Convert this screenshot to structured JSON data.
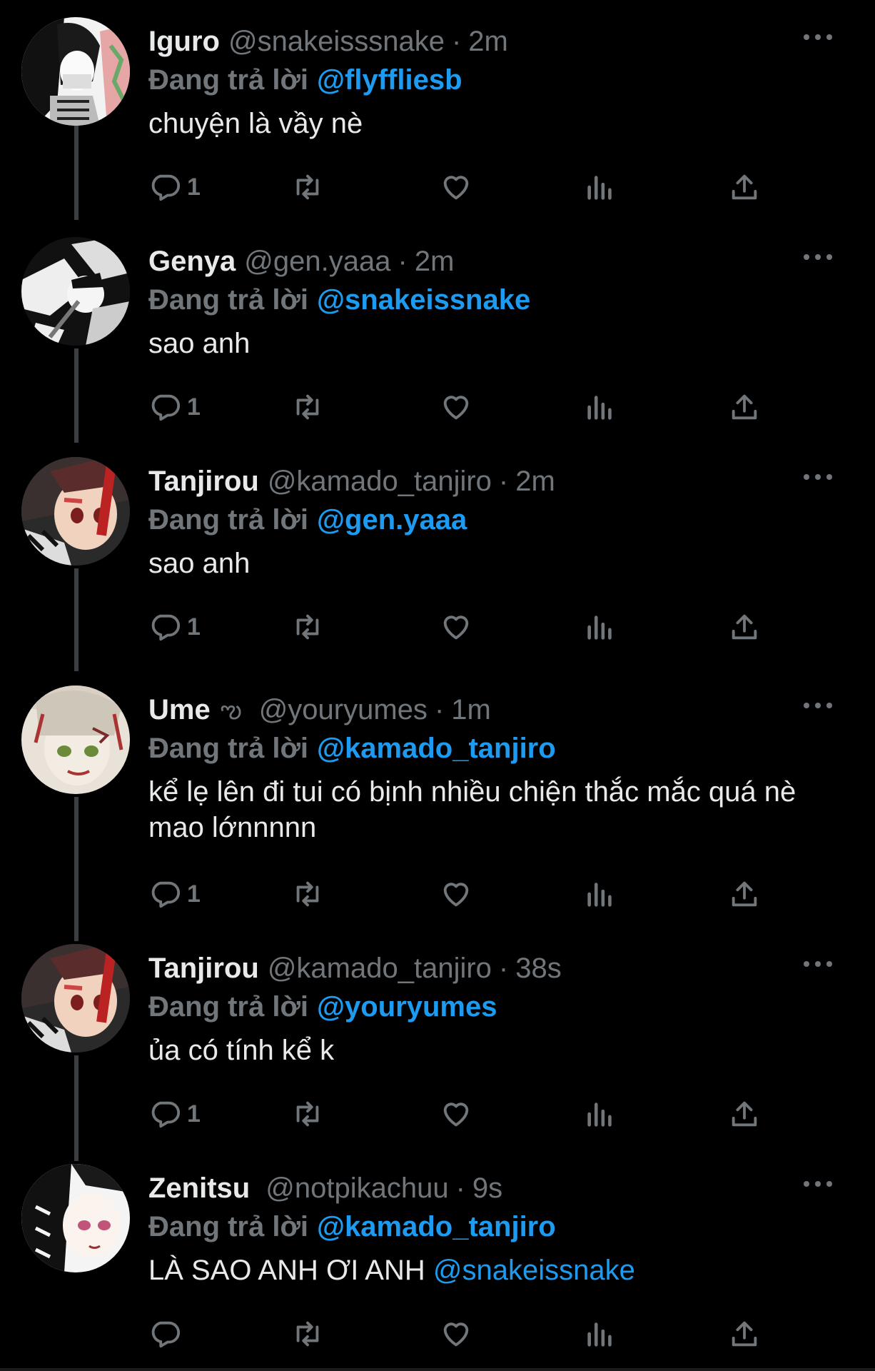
{
  "colors": {
    "background": "#000000",
    "accent": "#1d9bf0",
    "muted": "#71767b",
    "text": "#e7e9ea"
  },
  "icons": {
    "reply": "reply-icon",
    "retweet": "retweet-icon",
    "like": "heart-icon",
    "views": "views-icon",
    "share": "share-icon",
    "more": "more-icon"
  },
  "tweets": [
    {
      "name": "Iguro",
      "handle": "@snakeisssnake",
      "dot": "·",
      "time": "2m",
      "replying_label": "Đang trả lời",
      "replying_to": "@flyffliesb",
      "text": "chuyện là vầy nè",
      "text_mention": "",
      "reply_count": "1"
    },
    {
      "name": "Genya",
      "handle": "@gen.yaaa",
      "dot": "·",
      "time": "2m",
      "replying_label": "Đang trả lời",
      "replying_to": "@snakeissnake",
      "text": "sao anh",
      "text_mention": "",
      "reply_count": "1"
    },
    {
      "name": "Tanjirou",
      "handle": "@kamado_tanjiro",
      "dot": "·",
      "time": "2m",
      "replying_label": "Đang trả lời",
      "replying_to": "@gen.yaaa",
      "text": "sao anh",
      "text_mention": "",
      "reply_count": "1"
    },
    {
      "name": "Ume",
      "badge": "ఌ",
      "handle": "@youryumes",
      "dot": "·",
      "time": "1m",
      "replying_label": "Đang trả lời",
      "replying_to": "@kamado_tanjiro",
      "text": "kể lẹ lên đi tui có bịnh nhiều chiện thắc mắc quá nè mao lớnnnnn",
      "text_mention": "",
      "reply_count": "1"
    },
    {
      "name": "Tanjirou",
      "handle": "@kamado_tanjiro",
      "dot": "·",
      "time": "38s",
      "replying_label": "Đang trả lời",
      "replying_to": "@youryumes",
      "text": "ủa có tính kể k",
      "text_mention": "",
      "reply_count": "1"
    },
    {
      "name": "Zenitsu",
      "handle": "@notpikachuu",
      "dot": "·",
      "time": "9s",
      "replying_label": "Đang trả lời",
      "replying_to": "@kamado_tanjiro",
      "text": "LÀ SAO ANH ƠI ANH ",
      "text_mention": "@snakeissnake",
      "reply_count": ""
    }
  ]
}
